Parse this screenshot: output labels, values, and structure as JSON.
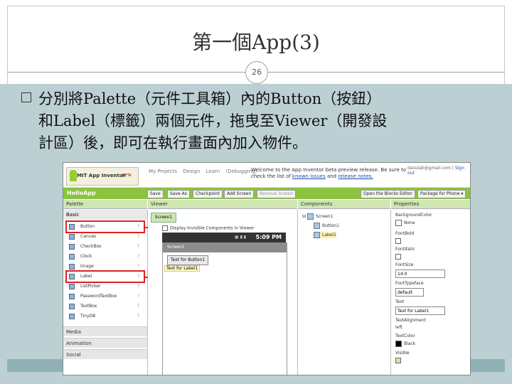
{
  "slide": {
    "title": "第一個App(3)",
    "page_number": "26",
    "bullet_line1": "分別將Palette（元件工具箱）內的Button（按鈕）",
    "bullet_line2": "和Label（標籤）兩個元件，拖曳至Viewer（開發設",
    "bullet_line3": "計區）後，即可在執行畫面內加入物件。"
  },
  "screenshot": {
    "logo": {
      "text": "MIT App Inventor",
      "badge": "BETA"
    },
    "nav": [
      "My Projects",
      "Design",
      "Learn",
      "(Debugging)"
    ],
    "welcome": {
      "text": "Welcome to the App Inventor beta preview release. Be sure to check the list of",
      "link1": "known issues",
      "and": "and",
      "link2": "release notes."
    },
    "account": {
      "email": "dasulab@gmail.com",
      "sep": "|",
      "signout": "Sign out"
    },
    "toolbar": {
      "app_name": "HelloApp",
      "save": "Save",
      "save_as": "Save As",
      "checkpoint": "Checkpoint",
      "add_screen": "Add Screen",
      "remove_screen": "Remove Screen",
      "open_blocks": "Open the Blocks Editor",
      "package": "Package for Phone ▾"
    },
    "palette": {
      "header": "Palette",
      "basic": "Basic",
      "items": [
        {
          "label": "Button",
          "icon": "button-icon"
        },
        {
          "label": "Canvas",
          "icon": "canvas-icon"
        },
        {
          "label": "CheckBox",
          "icon": "checkbox-icon"
        },
        {
          "label": "Clock",
          "icon": "clock-icon"
        },
        {
          "label": "Image",
          "icon": "image-icon"
        },
        {
          "label": "Label",
          "icon": "label-icon"
        },
        {
          "label": "ListPicker",
          "icon": "listpicker-icon"
        },
        {
          "label": "PasswordTextBox",
          "icon": "password-icon"
        },
        {
          "label": "TextBox",
          "icon": "textbox-icon"
        },
        {
          "label": "TinyDB",
          "icon": "tinydb-icon"
        }
      ],
      "help": "?",
      "categories": [
        "Media",
        "Animation",
        "Social"
      ]
    },
    "viewer": {
      "header": "Viewer",
      "screen_tab": "Screen1",
      "invisible_label": "Display Invisible Components in Viewer",
      "time": "5:09 PM",
      "screen_title": "Screen1",
      "button_text": "Text for Button1",
      "label_text": "Text for Label1"
    },
    "components": {
      "header": "Components",
      "root": "Screen1",
      "children": [
        "Button1",
        "Label1"
      ]
    },
    "properties": {
      "header": "Properties",
      "background_color_label": "BackgroundColor",
      "background_color_value": "None",
      "fontbold": "FontBold",
      "fontitalic": "FontItalic",
      "fontsize": "FontSize",
      "fontsize_value": "14.0",
      "fonttypeface": "FontTypeface",
      "fonttypeface_value": "default",
      "text_label": "Text",
      "text_value": "Text for Label1",
      "textalignment": "TextAlignment",
      "textalignment_value": "left",
      "textcolor": "TextColor",
      "textcolor_value": "Black",
      "visible": "Visible"
    }
  },
  "colors": {
    "app_green": "#8bc33f",
    "highlight_red": "#d22222",
    "slide_bg": "#bcd0d4"
  }
}
